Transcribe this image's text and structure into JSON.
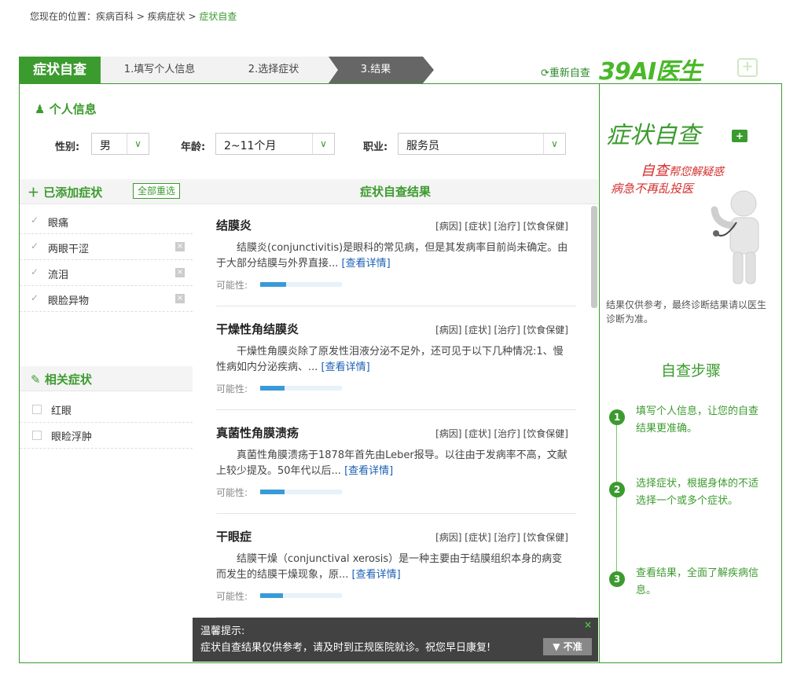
{
  "breadcrumb": {
    "prefix": "您现在的位置：疾病百科 > 疾病症状 > ",
    "current": "症状自查"
  },
  "steps": {
    "title": "症状自查",
    "step1": "1.填写个人信息",
    "step2": "2.选择症状",
    "step3": "3.结果",
    "restart": "重新自查",
    "logo": "39AI医生"
  },
  "personal": {
    "title": "个人信息",
    "gender_label": "性别:",
    "gender_value": "男",
    "age_label": "年龄:",
    "age_value": "2~11个月",
    "job_label": "职业:",
    "job_value": "服务员"
  },
  "added": {
    "title": "已添加症状",
    "reset": "全部重选",
    "items": [
      "眼痛",
      "两眼干涩",
      "流泪",
      "眼脸异物"
    ]
  },
  "related": {
    "title": "相关症状",
    "items": [
      "红眼",
      "眼睑浮肿"
    ]
  },
  "results": {
    "title": "症状自查结果",
    "prob_label": "可能性:",
    "links": "[病因] [症状] [治疗] [饮食保健]",
    "more": "[查看详情]",
    "items": [
      {
        "name": "结膜炎",
        "desc": "结膜炎(conjunctivitis)是眼科的常见病，但是其发病率目前尚未确定。由于大部分结膜与外界直接... ",
        "prob": 0.32
      },
      {
        "name": "干燥性角结膜炎",
        "desc": "干燥性角膜炎除了原发性泪液分泌不足外，还可见于以下几种情况:1、慢性病如内分泌疾病、... ",
        "prob": 0.3
      },
      {
        "name": "真菌性角膜溃疡",
        "desc": "真菌性角膜溃疡于1878年首先由Leber报导。以往由于发病率不高，文献上较少提及。50年代以后... ",
        "prob": 0.3
      },
      {
        "name": "干眼症",
        "desc": "结膜干燥（conjunctival xerosis）是一种主要由于结膜组织本身的病变而发生的结膜干燥现象，原... ",
        "prob": 0.28
      }
    ]
  },
  "tip": {
    "heading": "温馨提示:",
    "message": "症状自查结果仅供参考，请及时到正规医院就诊。祝您早日康复!",
    "close": "×",
    "inaccurate": "不准"
  },
  "sidebar": {
    "title": "症状自查",
    "slogan_em": "自查",
    "slogan_rest": "帮您解疑惑",
    "slogan2": "病急不再乱投医",
    "note": "结果仅供参考，最终诊断结果请以医生诊断为准。",
    "steps_title": "自查步骤",
    "steps": [
      {
        "num": "1",
        "text": "填写个人信息，让您的自查结果更准确。"
      },
      {
        "num": "2",
        "text": "选择症状，根据身体的不适选择一个或多个症状。"
      },
      {
        "num": "3",
        "text": "查看结果，全面了解疾病信息。"
      }
    ]
  },
  "colors": {
    "brand": "#3c9b2f",
    "link": "#1a5fb4",
    "slogan": "#d3302f",
    "bar": "#3a9ad9"
  }
}
